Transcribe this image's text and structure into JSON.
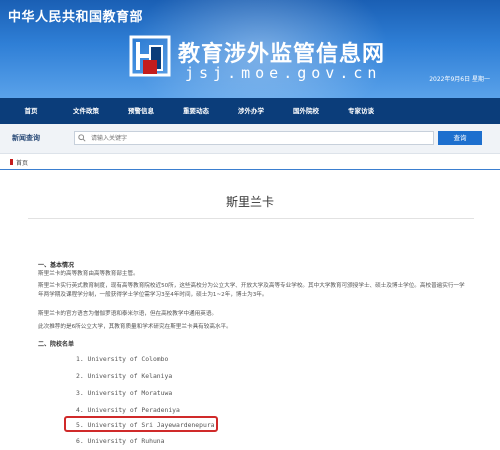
{
  "header": {
    "ministry": "中华人民共和国教育部",
    "site_name": "教育涉外监管信息网",
    "domain": "jsj.moe.gov.cn",
    "date": "2022年9月6日 星期一"
  },
  "nav": {
    "items": [
      {
        "label": "首页"
      },
      {
        "label": "文件政策"
      },
      {
        "label": "预警信息"
      },
      {
        "label": "重要动态"
      },
      {
        "label": "涉外办学"
      },
      {
        "label": "国外院校"
      },
      {
        "label": "专家访谈"
      }
    ]
  },
  "search": {
    "title": "新闻查询",
    "placeholder": "请输入关键字",
    "button": "查询"
  },
  "breadcrumb": {
    "text": "首页"
  },
  "article": {
    "title": "斯里兰卡",
    "section1": "一、基本情况",
    "para1": "斯里兰卡的高等教育由高等教育部主管。",
    "para2": "斯里兰卡实行英式教育制度，现有高等教育院校近50所，这些高校分为公立大学、开放大学及高等专业学校。其中大学教育可颁授学士、硕士及博士学位。高校普遍实行一学年两学期及课程学分制，一般获得学士学位需学习3至4年时间，硕士为1~2年，博士为3年。",
    "para3": "斯里兰卡的官方语言为僧伽罗语和泰米尔语，但在高校教学中通用英语。",
    "para4": "此次推荐的是6所公立大学，其教育质量和学术研究在斯里兰卡具有较高水平。",
    "section2": "二、院校名单",
    "universities": [
      "1. University of Colombo",
      "2. University of Kelaniya",
      "3. University of Moratuwa",
      "4. University of Peradeniya",
      "5. University of Sri Jayewardenepura",
      "6. University of Ruhuna"
    ]
  },
  "colors": {
    "banner": "#1a5fb4",
    "nav": "#0b3d7a",
    "search_button": "#1d6fce",
    "highlight": "#d02a2a"
  }
}
